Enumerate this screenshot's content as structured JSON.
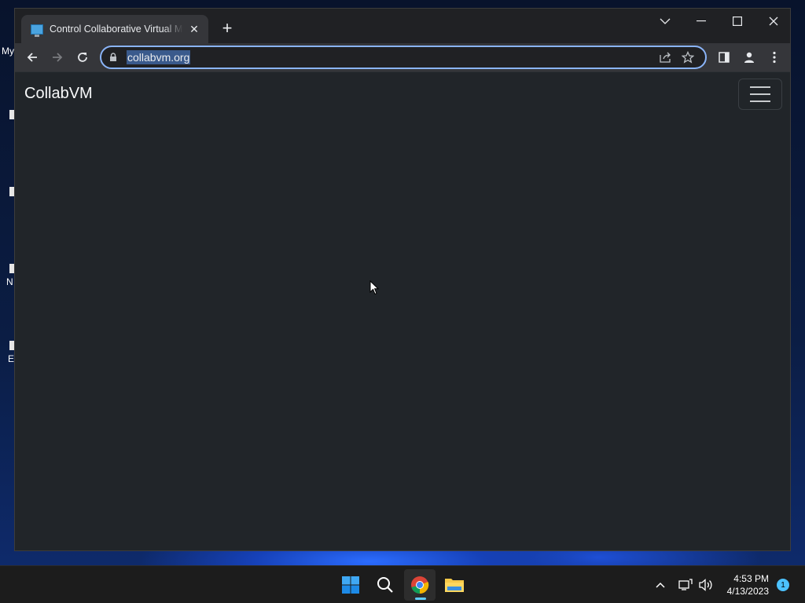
{
  "desktop": {
    "icons": [
      {
        "label": "My"
      },
      {
        "label": ""
      },
      {
        "label": ""
      },
      {
        "label": "N"
      },
      {
        "label": "E"
      }
    ]
  },
  "browser": {
    "tab": {
      "title": "Control Collaborative Virtual Machines",
      "close_label": "✕"
    },
    "new_tab_label": "+",
    "window_controls": {
      "dropdown": "⌵",
      "minimize": "—",
      "maximize": "☐",
      "close": "✕"
    },
    "address_bar": {
      "url": "collabvm.org"
    }
  },
  "page": {
    "brand": "CollabVM"
  },
  "taskbar": {
    "apps": [
      "start-icon",
      "search-icon",
      "chrome-icon",
      "file-explorer-icon"
    ],
    "tray": {
      "chevron": "^"
    },
    "clock": {
      "time": "4:53 PM",
      "date": "4/13/2023"
    },
    "notification_count": "1"
  },
  "colors": {
    "accent": "#8ab4f8",
    "page_bg": "#212529",
    "taskbar_indicator": "#60cdff"
  }
}
